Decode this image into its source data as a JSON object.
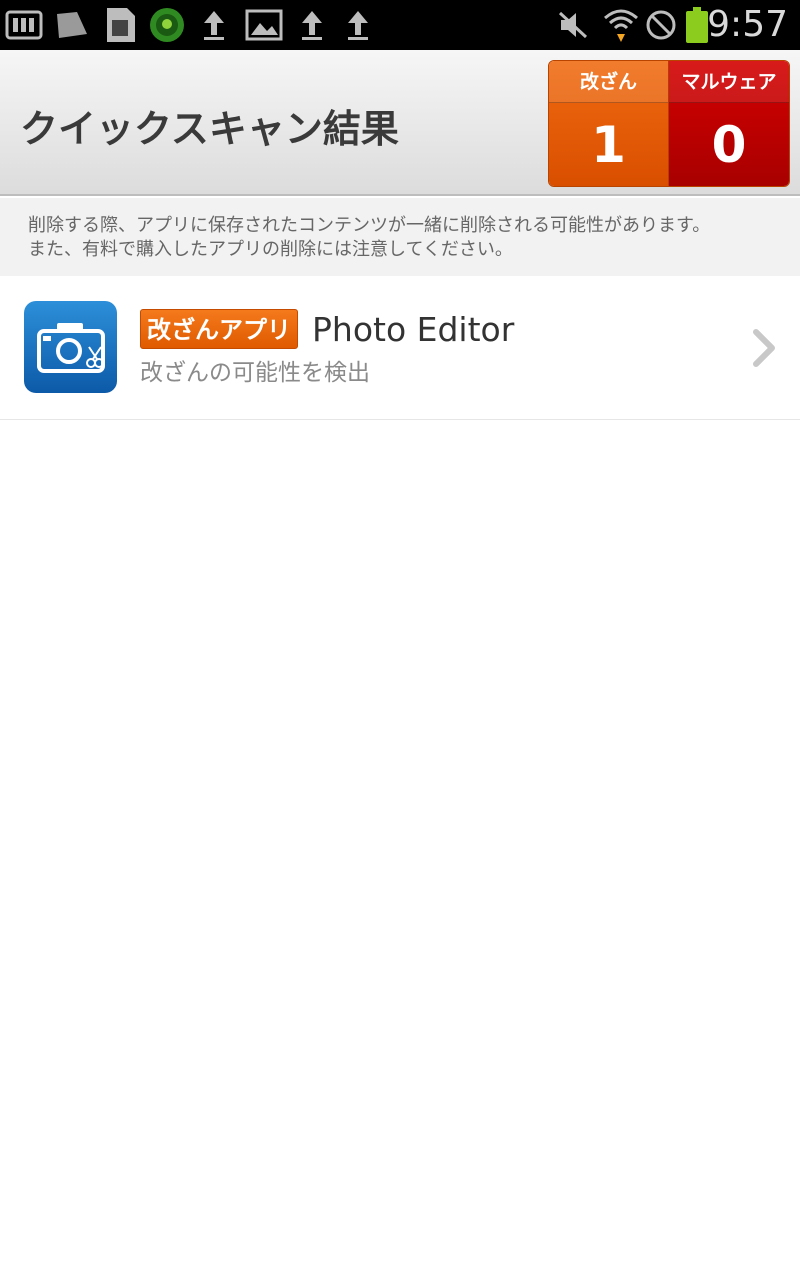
{
  "status_bar": {
    "time": "9:57",
    "icons": [
      "sd-card-icon",
      "photo-icon",
      "sim-icon",
      "security-shield-icon",
      "upload-icon",
      "gallery-icon",
      "upload-icon",
      "upload-icon",
      "mute-icon",
      "wifi-icon",
      "block-icon",
      "battery-icon"
    ]
  },
  "header": {
    "title": "クイックスキャン結果"
  },
  "counts": {
    "tamper_label": "改ざん",
    "tamper_value": "1",
    "malware_label": "マルウェア",
    "malware_value": "0"
  },
  "notice": {
    "line1": "削除する際、アプリに保存されたコンテンツが一緒に削除される可能性があります。",
    "line2": "また、有料で購入したアプリの削除には注意してください。"
  },
  "results": [
    {
      "badge": "改ざんアプリ",
      "name": "Photo Editor",
      "description": "改ざんの可能性を検出",
      "icon": "photo-editor-camera-icon"
    }
  ],
  "colors": {
    "tamper": "#e55a00",
    "malware": "#c00000",
    "badge": "#ec6a10"
  }
}
